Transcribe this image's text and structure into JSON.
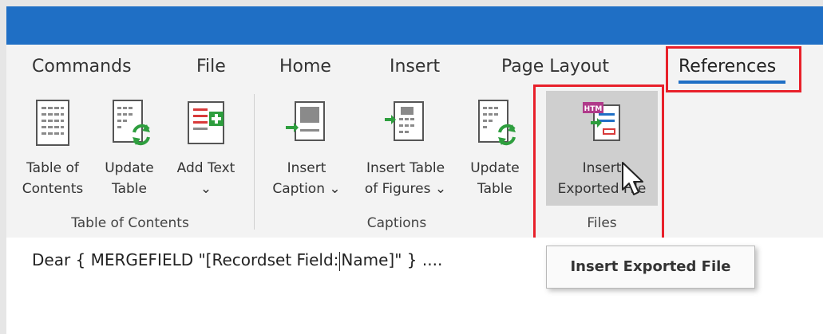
{
  "tabs": [
    {
      "label": "Commands"
    },
    {
      "label": "File"
    },
    {
      "label": "Home"
    },
    {
      "label": "Insert"
    },
    {
      "label": "Page Layout"
    },
    {
      "label": "References"
    }
  ],
  "groups": {
    "toc": {
      "label": "Table of Contents",
      "buttons": [
        {
          "line1": "Table of",
          "line2": "Contents"
        },
        {
          "line1": "Update",
          "line2": "Table"
        },
        {
          "line1": "Add Text",
          "line2": "⌄"
        }
      ]
    },
    "captions": {
      "label": "Captions",
      "buttons": [
        {
          "line1": "Insert",
          "line2": "Caption ⌄"
        },
        {
          "line1": "Insert Table",
          "line2": "of Figures ⌄"
        },
        {
          "line1": "Update",
          "line2": "Table"
        }
      ]
    },
    "files": {
      "label": "Files",
      "buttons": [
        {
          "line1": "Insert",
          "line2": "Exported File"
        }
      ]
    }
  },
  "document": {
    "text_before": "Dear { MERGEFIELD \"[Recordset Field:",
    "text_after": "Name]\" } ...."
  },
  "tooltip": {
    "text": "Insert Exported File"
  },
  "colors": {
    "accent": "#1f6fc5",
    "highlight": "#e8202a",
    "green": "#2e9e3e"
  }
}
